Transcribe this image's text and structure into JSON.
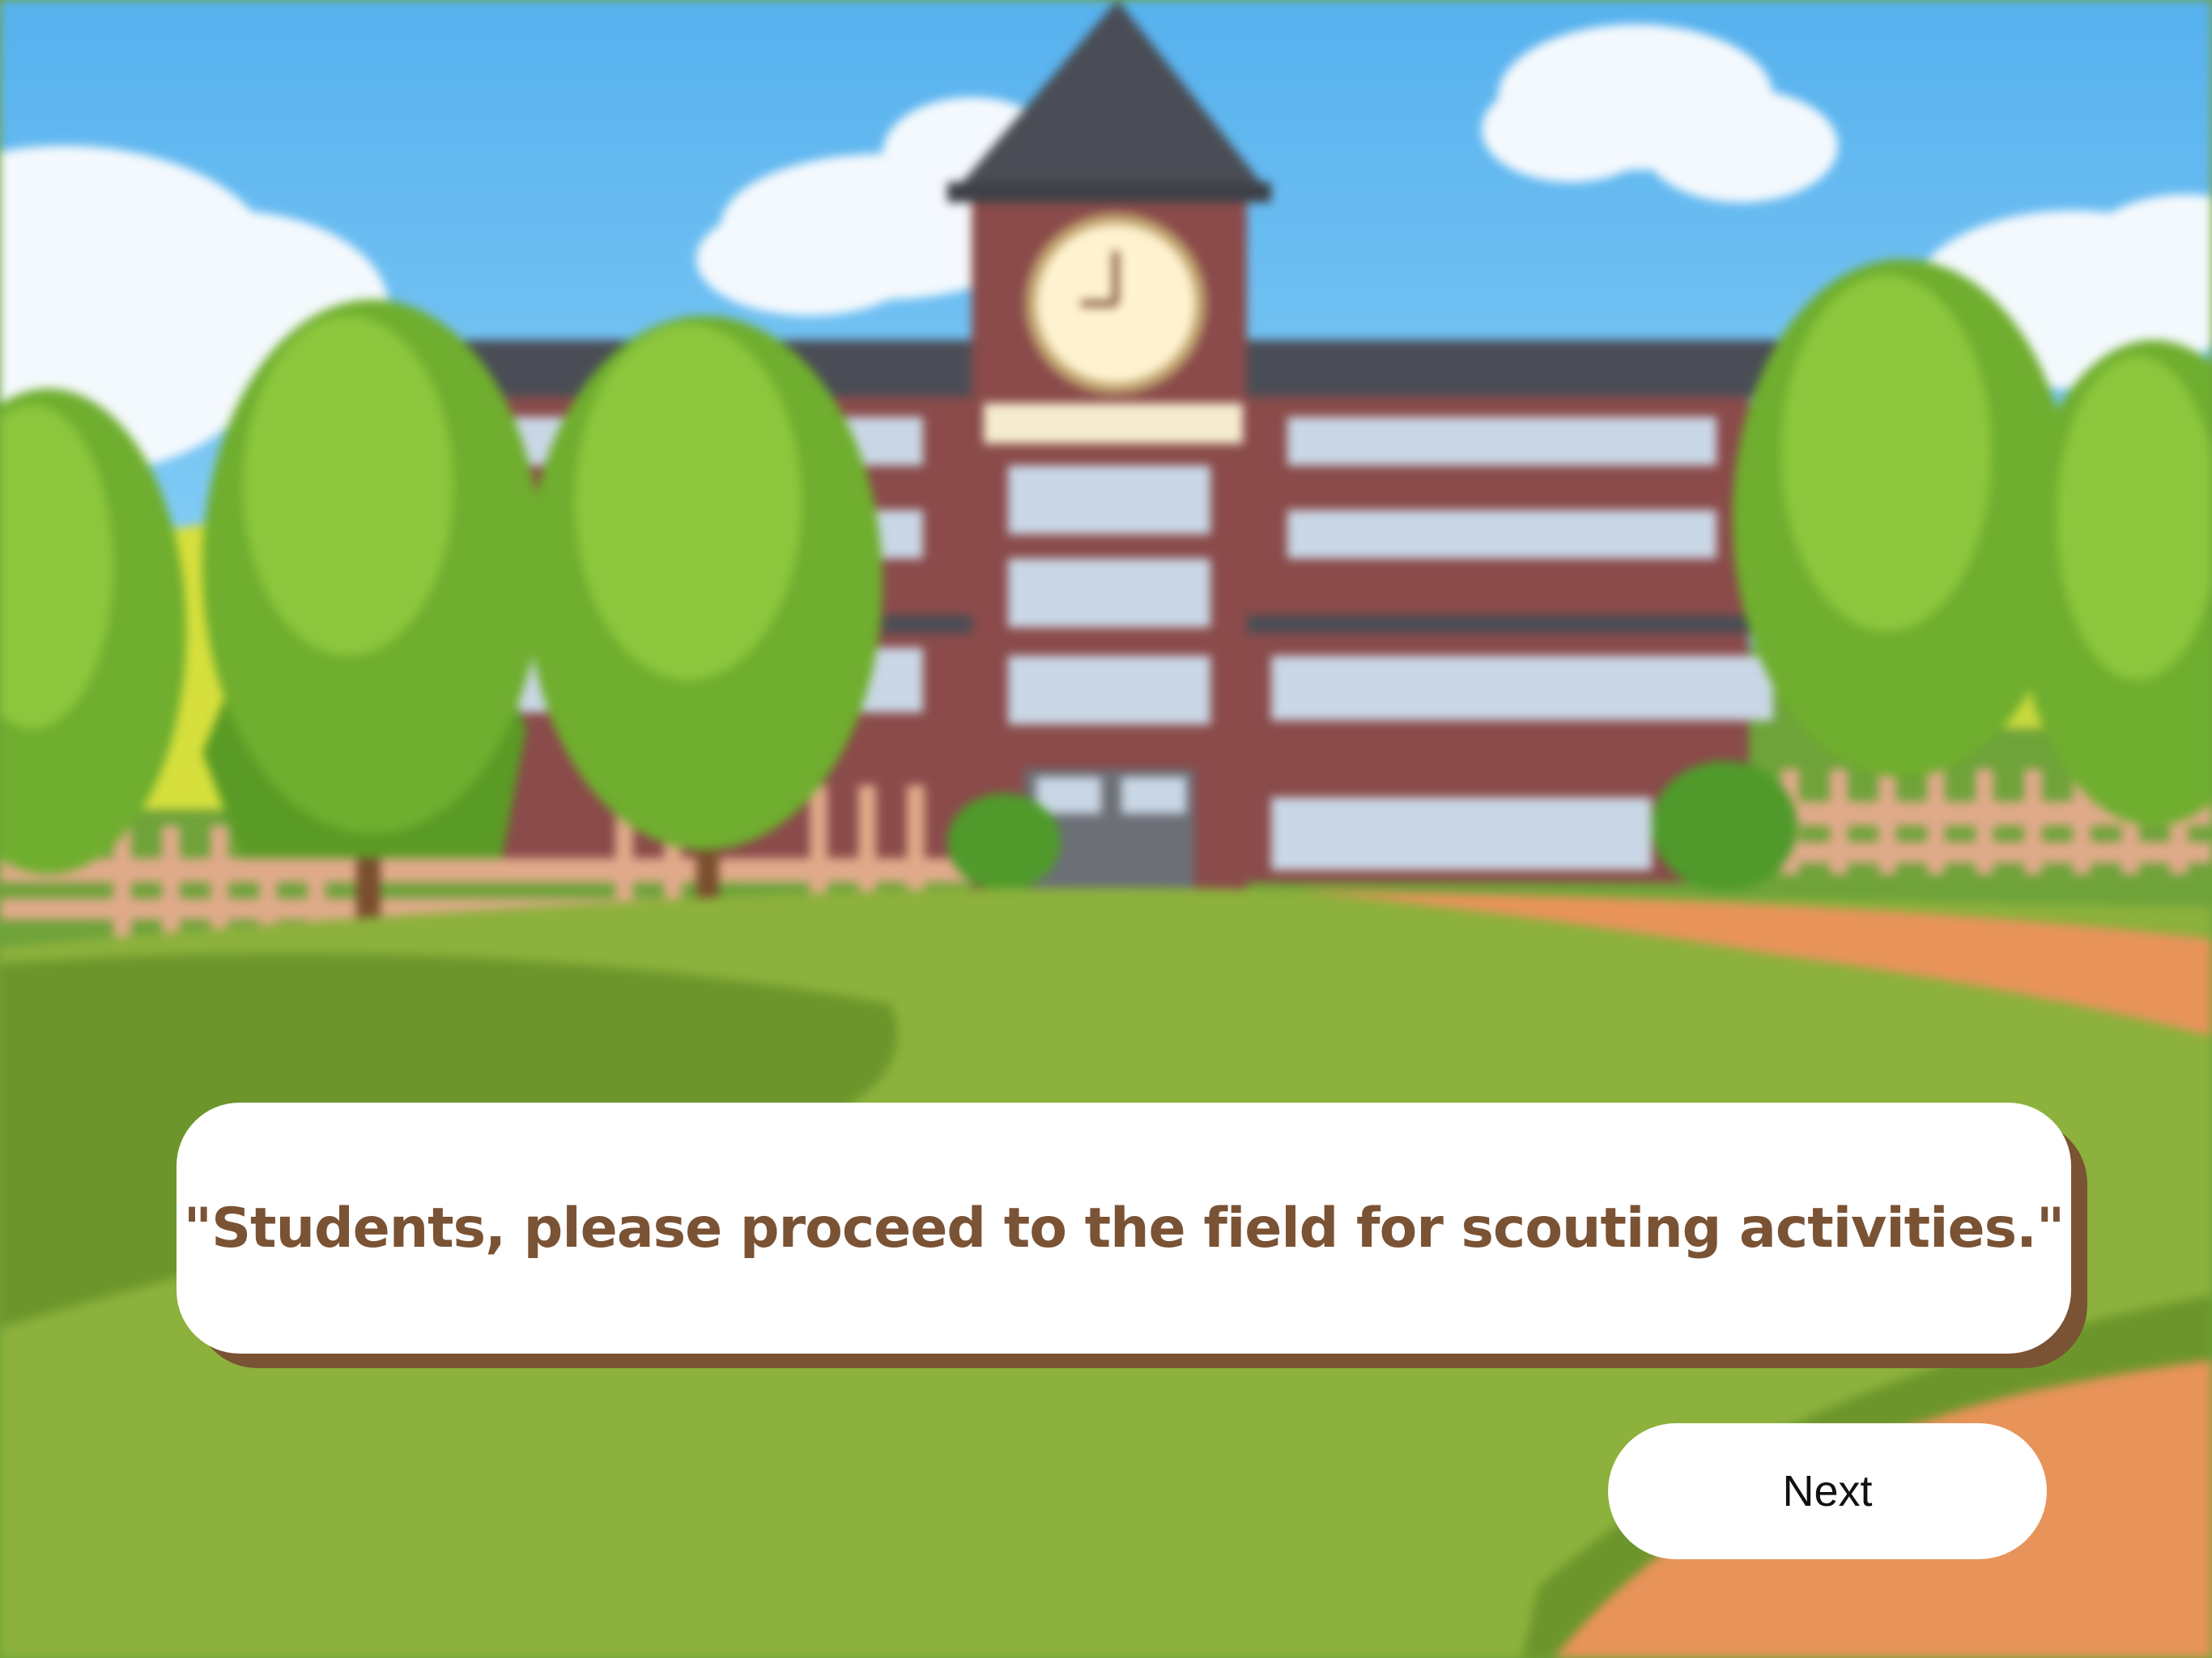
{
  "dialog": {
    "text": "\"Students, please proceed to the field for scouting activities.\""
  },
  "controls": {
    "next_label": "Next"
  },
  "colors": {
    "sky": "#5fb6f0",
    "grass": "#8cb13c",
    "dark_grass": "#6c962b",
    "path": "#e8935a",
    "building_brick": "#8a4b4a",
    "roof": "#4a4d55",
    "dialog_text": "#7a5234",
    "dialog_shadow": "#7a5234",
    "button_bg": "#ffffff"
  },
  "icons": {
    "clock": "clock-icon"
  }
}
